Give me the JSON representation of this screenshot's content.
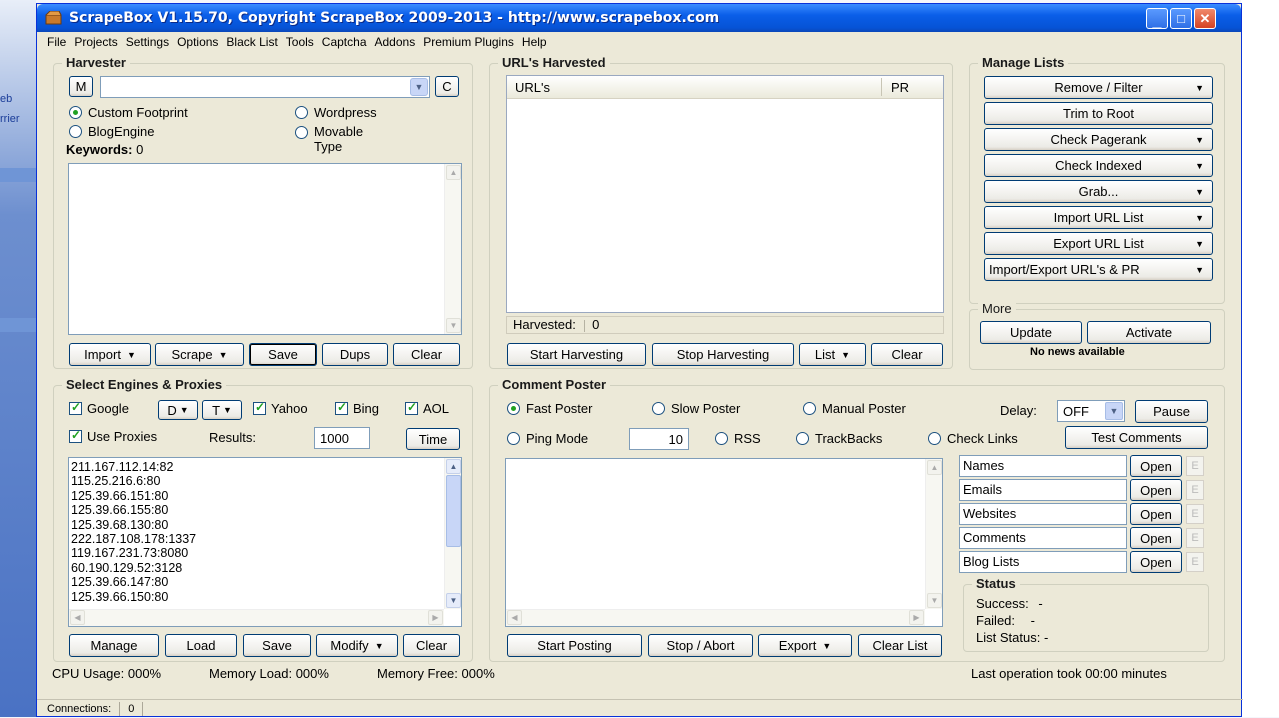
{
  "background": {
    "left_text1": "eb",
    "left_text2": "rrier"
  },
  "window": {
    "title": "ScrapeBox V1.15.70, Copyright ScrapeBox 2009-2013 - http://www.scrapebox.com"
  },
  "menu": [
    "File",
    "Projects",
    "Settings",
    "Options",
    "Black List",
    "Tools",
    "Captcha",
    "Addons",
    "Premium Plugins",
    "Help"
  ],
  "harvester": {
    "label": "Harvester",
    "m_btn": "M",
    "c_btn": "C",
    "radios": {
      "custom": "Custom Footprint",
      "wordpress": "Wordpress",
      "blogengine": "BlogEngine",
      "movable": "Movable Type"
    },
    "keywords_label": "Keywords:",
    "keywords_count": "0",
    "buttons": {
      "import": "Import",
      "scrape": "Scrape",
      "save": "Save",
      "dups": "Dups",
      "clear": "Clear"
    }
  },
  "urls": {
    "label": "URL's Harvested",
    "col_url": "URL's",
    "col_pr": "PR",
    "harvested_label": "Harvested:",
    "harvested_count": "0",
    "buttons": {
      "start": "Start Harvesting",
      "stop": "Stop Harvesting",
      "list": "List",
      "clear": "Clear"
    }
  },
  "manage": {
    "label": "Manage Lists",
    "buttons": [
      "Remove / Filter",
      "Trim to Root",
      "Check Pagerank",
      "Check Indexed",
      "Grab...",
      "Import URL List",
      "Export URL List",
      "Import/Export URL's & PR"
    ],
    "more_label": "More",
    "update": "Update",
    "activate": "Activate",
    "news": "No news available"
  },
  "engines": {
    "label": "Select Engines & Proxies",
    "google": "Google",
    "d_drop": "D",
    "t_drop": "T",
    "yahoo": "Yahoo",
    "bing": "Bing",
    "aol": "AOL",
    "use_proxies": "Use Proxies",
    "results_label": "Results:",
    "results_value": "1000",
    "time_btn": "Time",
    "proxies": [
      "211.167.112.14:82",
      "115.25.216.6:80",
      "125.39.66.151:80",
      "125.39.66.155:80",
      "125.39.68.130:80",
      "222.187.108.178:1337",
      "119.167.231.73:8080",
      "60.190.129.52:3128",
      "125.39.66.147:80",
      "125.39.66.150:80"
    ],
    "buttons": {
      "manage": "Manage",
      "load": "Load",
      "save": "Save",
      "modify": "Modify",
      "clear": "Clear"
    }
  },
  "poster": {
    "label": "Comment Poster",
    "fast": "Fast Poster",
    "slow": "Slow Poster",
    "manual": "Manual Poster",
    "delay_label": "Delay:",
    "delay_value": "OFF",
    "pause": "Pause",
    "ping": "Ping Mode",
    "ping_value": "10",
    "rss": "RSS",
    "trackbacks": "TrackBacks",
    "checklinks": "Check Links",
    "test": "Test Comments",
    "lists": [
      "Names",
      "Emails",
      "Websites",
      "Comments",
      "Blog Lists"
    ],
    "open": "Open",
    "e": "E",
    "status_label": "Status",
    "success": "Success:",
    "success_val": "-",
    "failed": "Failed:",
    "failed_val": "-",
    "list_status": "List Status:",
    "list_status_val": "-",
    "buttons": {
      "start": "Start Posting",
      "stop": "Stop / Abort",
      "export": "Export",
      "clear": "Clear List"
    }
  },
  "footer": {
    "cpu": "CPU Usage: 000%",
    "memload": "Memory Load: 000%",
    "memfree": "Memory Free: 000%",
    "lastop": "Last operation took 00:00 minutes",
    "connections_label": "Connections:",
    "connections_val": "0"
  }
}
